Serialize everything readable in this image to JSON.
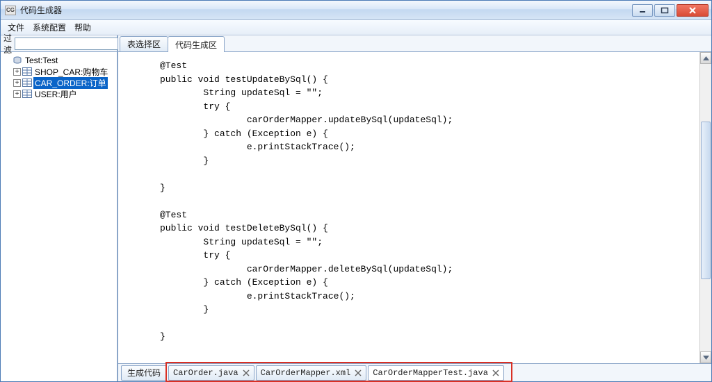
{
  "window": {
    "app_abbrev": "CG",
    "title": "代码生成器"
  },
  "menubar": {
    "items": [
      "文件",
      "系统配置",
      "帮助"
    ]
  },
  "sidebar": {
    "filter_label": "过滤",
    "filter_value": "",
    "root": {
      "label": "Test:Test"
    },
    "children": [
      {
        "label": "SHOP_CAR:购物车",
        "selected": false
      },
      {
        "label": "CAR_ORDER:订单",
        "selected": true
      },
      {
        "label": "USER:用户",
        "selected": false
      }
    ]
  },
  "top_tabs": [
    {
      "label": "表选择区",
      "active": false
    },
    {
      "label": "代码生成区",
      "active": true
    }
  ],
  "code": "@Test\npublic void testUpdateBySql() {\n        String updateSql = \"\";\n        try {\n                carOrderMapper.updateBySql(updateSql);\n        } catch (Exception e) {\n                e.printStackTrace();\n        }\n\n}\n\n@Test\npublic void testDeleteBySql() {\n        String updateSql = \"\";\n        try {\n                carOrderMapper.deleteBySql(updateSql);\n        } catch (Exception e) {\n                e.printStackTrace();\n        }\n\n}",
  "bottom": {
    "label": "生成代码",
    "tabs": [
      {
        "name": "CarOrder.java",
        "active": false
      },
      {
        "name": "CarOrderMapper.xml",
        "active": false
      },
      {
        "name": "CarOrderMapperTest.java",
        "active": true
      }
    ]
  },
  "scrollbar": {
    "thumb_top_pct": 20,
    "thumb_height_pct": 55
  }
}
